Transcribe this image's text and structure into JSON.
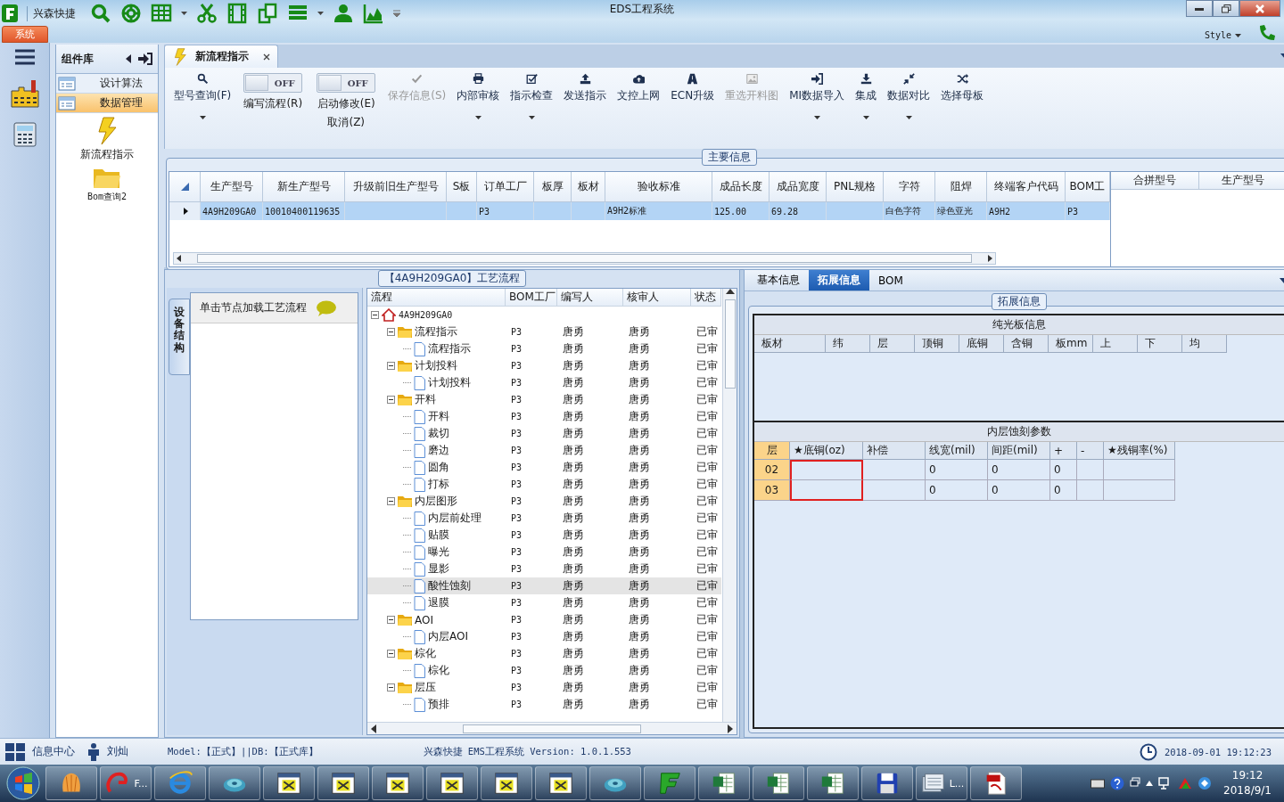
{
  "titlebar": {
    "app_name": "兴森快捷",
    "title": "EDS工程系统",
    "style_menu": "Style"
  },
  "ribbon_tab": "系统",
  "sidebar": {
    "title": "组件库",
    "items": [
      {
        "label": "设计算法",
        "selected": false
      },
      {
        "label": "数据管理",
        "selected": true
      }
    ],
    "shortcuts": [
      {
        "label": "新流程指示",
        "kind": "bolt"
      },
      {
        "label": "Bom查询2",
        "kind": "folder"
      }
    ]
  },
  "document_tab": {
    "label": "新流程指示"
  },
  "toolbar": {
    "items": [
      {
        "kind": "button",
        "label": "型号查询(F)",
        "dropdown": true,
        "disabled": false
      },
      {
        "kind": "toggle",
        "switch_text": "OFF",
        "label": "编写流程(R)",
        "on": false
      },
      {
        "kind": "toggle",
        "switch_text": "OFF",
        "label": "启动修改(E)",
        "sublabel": "取消(Z)",
        "on": false
      },
      {
        "kind": "button",
        "label": "保存信息(S)",
        "dropdown": false,
        "disabled": true
      },
      {
        "kind": "button",
        "label": "内部审核",
        "dropdown": true,
        "disabled": false
      },
      {
        "kind": "button",
        "label": "指示检查",
        "dropdown": true,
        "disabled": false
      },
      {
        "kind": "button",
        "label": "发送指示",
        "dropdown": false,
        "disabled": false
      },
      {
        "kind": "button",
        "label": "文控上网",
        "dropdown": false,
        "disabled": false
      },
      {
        "kind": "button",
        "label": "ECN升级",
        "dropdown": false,
        "disabled": false
      },
      {
        "kind": "button",
        "label": "重选开料图",
        "dropdown": false,
        "disabled": true
      },
      {
        "kind": "button",
        "label": "MI数据导入",
        "dropdown": true,
        "disabled": false
      },
      {
        "kind": "button",
        "label": "集成",
        "dropdown": true,
        "disabled": false
      },
      {
        "kind": "button",
        "label": "数据对比",
        "dropdown": true,
        "disabled": false
      },
      {
        "kind": "button",
        "label": "选择母板",
        "dropdown": false,
        "disabled": false
      }
    ]
  },
  "main_info": {
    "title": "主要信息",
    "columns": [
      "生产型号",
      "新生产型号",
      "升级前旧生产型号",
      "S板",
      "订单工厂",
      "板厚",
      "板材",
      "验收标准",
      "成品长度",
      "成品宽度",
      "PNL规格",
      "字符",
      "阻焊",
      "终端客户代码",
      "BOM工"
    ],
    "rows": [
      {
        "selected": true,
        "cells": [
          "4A9H209GA0",
          "10010400119635",
          null,
          null,
          "P3",
          null,
          null,
          "A9H2标准",
          "125.00",
          "69.28",
          null,
          "白色字符",
          "绿色亚光",
          "A9H2",
          "P3"
        ]
      }
    ],
    "side_columns": [
      "合拼型号",
      "生产型号"
    ]
  },
  "process": {
    "title": "【4A9H209GA0】工艺流程",
    "side_tab": "设备结构",
    "hint": "单击节点加载工艺流程",
    "columns": [
      "流程",
      "BOM工厂",
      "编写人",
      "核审人",
      "状态"
    ],
    "tree": [
      {
        "kind": "root",
        "label": "4A9H209GA0",
        "expanded": true,
        "selected": false,
        "children": [
          {
            "kind": "folder",
            "label": "流程指示",
            "bom": "P3",
            "writer": "唐勇",
            "reviewer": "唐勇",
            "status": "已审",
            "expanded": true,
            "selected": false,
            "children": [
              {
                "kind": "file",
                "label": "流程指示",
                "bom": "P3",
                "writer": "唐勇",
                "reviewer": "唐勇",
                "status": "已审",
                "selected": false
              }
            ]
          },
          {
            "kind": "folder",
            "label": "计划投料",
            "bom": "P3",
            "writer": "唐勇",
            "reviewer": "唐勇",
            "status": "已审",
            "expanded": true,
            "selected": false,
            "children": [
              {
                "kind": "file",
                "label": "计划投料",
                "bom": "P3",
                "writer": "唐勇",
                "reviewer": "唐勇",
                "status": "已审",
                "selected": false
              }
            ]
          },
          {
            "kind": "folder",
            "label": "开料",
            "bom": "P3",
            "writer": "唐勇",
            "reviewer": "唐勇",
            "status": "已审",
            "expanded": true,
            "selected": false,
            "children": [
              {
                "kind": "file",
                "label": "开料",
                "bom": "P3",
                "writer": "唐勇",
                "reviewer": "唐勇",
                "status": "已审",
                "selected": false
              },
              {
                "kind": "file",
                "label": "裁切",
                "bom": "P3",
                "writer": "唐勇",
                "reviewer": "唐勇",
                "status": "已审",
                "selected": false
              },
              {
                "kind": "file",
                "label": "磨边",
                "bom": "P3",
                "writer": "唐勇",
                "reviewer": "唐勇",
                "status": "已审",
                "selected": false
              },
              {
                "kind": "file",
                "label": "圆角",
                "bom": "P3",
                "writer": "唐勇",
                "reviewer": "唐勇",
                "status": "已审",
                "selected": false
              },
              {
                "kind": "file",
                "label": "打标",
                "bom": "P3",
                "writer": "唐勇",
                "reviewer": "唐勇",
                "status": "已审",
                "selected": false
              }
            ]
          },
          {
            "kind": "folder",
            "label": "内层图形",
            "bom": "P3",
            "writer": "唐勇",
            "reviewer": "唐勇",
            "status": "已审",
            "expanded": true,
            "selected": false,
            "children": [
              {
                "kind": "file",
                "label": "内层前处理",
                "bom": "P3",
                "writer": "唐勇",
                "reviewer": "唐勇",
                "status": "已审",
                "selected": false
              },
              {
                "kind": "file",
                "label": "贴膜",
                "bom": "P3",
                "writer": "唐勇",
                "reviewer": "唐勇",
                "status": "已审",
                "selected": false
              },
              {
                "kind": "file",
                "label": "曝光",
                "bom": "P3",
                "writer": "唐勇",
                "reviewer": "唐勇",
                "status": "已审",
                "selected": false
              },
              {
                "kind": "file",
                "label": "显影",
                "bom": "P3",
                "writer": "唐勇",
                "reviewer": "唐勇",
                "status": "已审",
                "selected": false
              },
              {
                "kind": "file",
                "label": "酸性蚀刻",
                "bom": "P3",
                "writer": "唐勇",
                "reviewer": "唐勇",
                "status": "已审",
                "selected": true
              },
              {
                "kind": "file",
                "label": "退膜",
                "bom": "P3",
                "writer": "唐勇",
                "reviewer": "唐勇",
                "status": "已审",
                "selected": false
              }
            ]
          },
          {
            "kind": "folder",
            "label": "AOI",
            "bom": "P3",
            "writer": "唐勇",
            "reviewer": "唐勇",
            "status": "已审",
            "expanded": true,
            "selected": false,
            "children": [
              {
                "kind": "file",
                "label": "内层AOI",
                "bom": "P3",
                "writer": "唐勇",
                "reviewer": "唐勇",
                "status": "已审",
                "selected": false
              }
            ]
          },
          {
            "kind": "folder",
            "label": "棕化",
            "bom": "P3",
            "writer": "唐勇",
            "reviewer": "唐勇",
            "status": "已审",
            "expanded": true,
            "selected": false,
            "children": [
              {
                "kind": "file",
                "label": "棕化",
                "bom": "P3",
                "writer": "唐勇",
                "reviewer": "唐勇",
                "status": "已审",
                "selected": false
              }
            ]
          },
          {
            "kind": "folder",
            "label": "层压",
            "bom": "P3",
            "writer": "唐勇",
            "reviewer": "唐勇",
            "status": "已审",
            "expanded": true,
            "selected": false,
            "children": [
              {
                "kind": "file",
                "label": "预排",
                "bom": "P3",
                "writer": "唐勇",
                "reviewer": "唐勇",
                "status": "已审",
                "selected": false
              }
            ]
          }
        ]
      }
    ]
  },
  "detail": {
    "tabs": [
      {
        "label": "基本信息",
        "selected": false
      },
      {
        "label": "拓展信息",
        "selected": true
      },
      {
        "label": "BOM",
        "selected": false
      }
    ],
    "title": "拓展信息",
    "plain_board": {
      "title": "纯光板信息",
      "columns": [
        "板材",
        "纬",
        "层",
        "顶铜",
        "底铜",
        "含铜",
        "板mm",
        "上",
        "下",
        "均"
      ]
    },
    "inner_etch": {
      "title": "内层蚀刻参数",
      "columns": [
        {
          "label": "层",
          "flagged": false
        },
        {
          "label": "★底铜(oz)",
          "flagged": true
        },
        {
          "label": "补偿",
          "flagged": false
        },
        {
          "label": "线宽(mil)",
          "flagged": false
        },
        {
          "label": "间距(mil)",
          "flagged": false
        },
        {
          "label": "+",
          "flagged": false
        },
        {
          "label": "-",
          "flagged": false
        },
        {
          "label": "★残铜率(%)",
          "flagged": false
        }
      ],
      "rows": [
        {
          "cells": [
            "02",
            null,
            null,
            "0",
            "0",
            "0",
            null,
            null
          ]
        },
        {
          "cells": [
            "03",
            null,
            null,
            "0",
            "0",
            "0",
            null,
            null
          ]
        }
      ]
    }
  },
  "status_bar": {
    "info_center": "信息中心",
    "user": "刘灿",
    "model_db": "Model:【正式】||DB:【正式库】",
    "version": "兴森快捷 EMS工程系统 Version: 1.0.1.553",
    "datetime": "2018-09-01 19:12:23"
  },
  "taskbar": {
    "items": [
      {
        "kind": "shell"
      },
      {
        "kind": "app",
        "label": "F..."
      },
      {
        "kind": "browser"
      },
      {
        "kind": "disc"
      },
      {
        "kind": "window"
      },
      {
        "kind": "window"
      },
      {
        "kind": "window"
      },
      {
        "kind": "window"
      },
      {
        "kind": "window"
      },
      {
        "kind": "window"
      },
      {
        "kind": "disc"
      },
      {
        "kind": "green-f"
      },
      {
        "kind": "sheet"
      },
      {
        "kind": "sheet"
      },
      {
        "kind": "sheet"
      },
      {
        "kind": "floppy"
      },
      {
        "kind": "docs",
        "label": "L..."
      },
      {
        "kind": "pdf"
      }
    ],
    "time": "19:12",
    "date": "2018/9/1"
  }
}
